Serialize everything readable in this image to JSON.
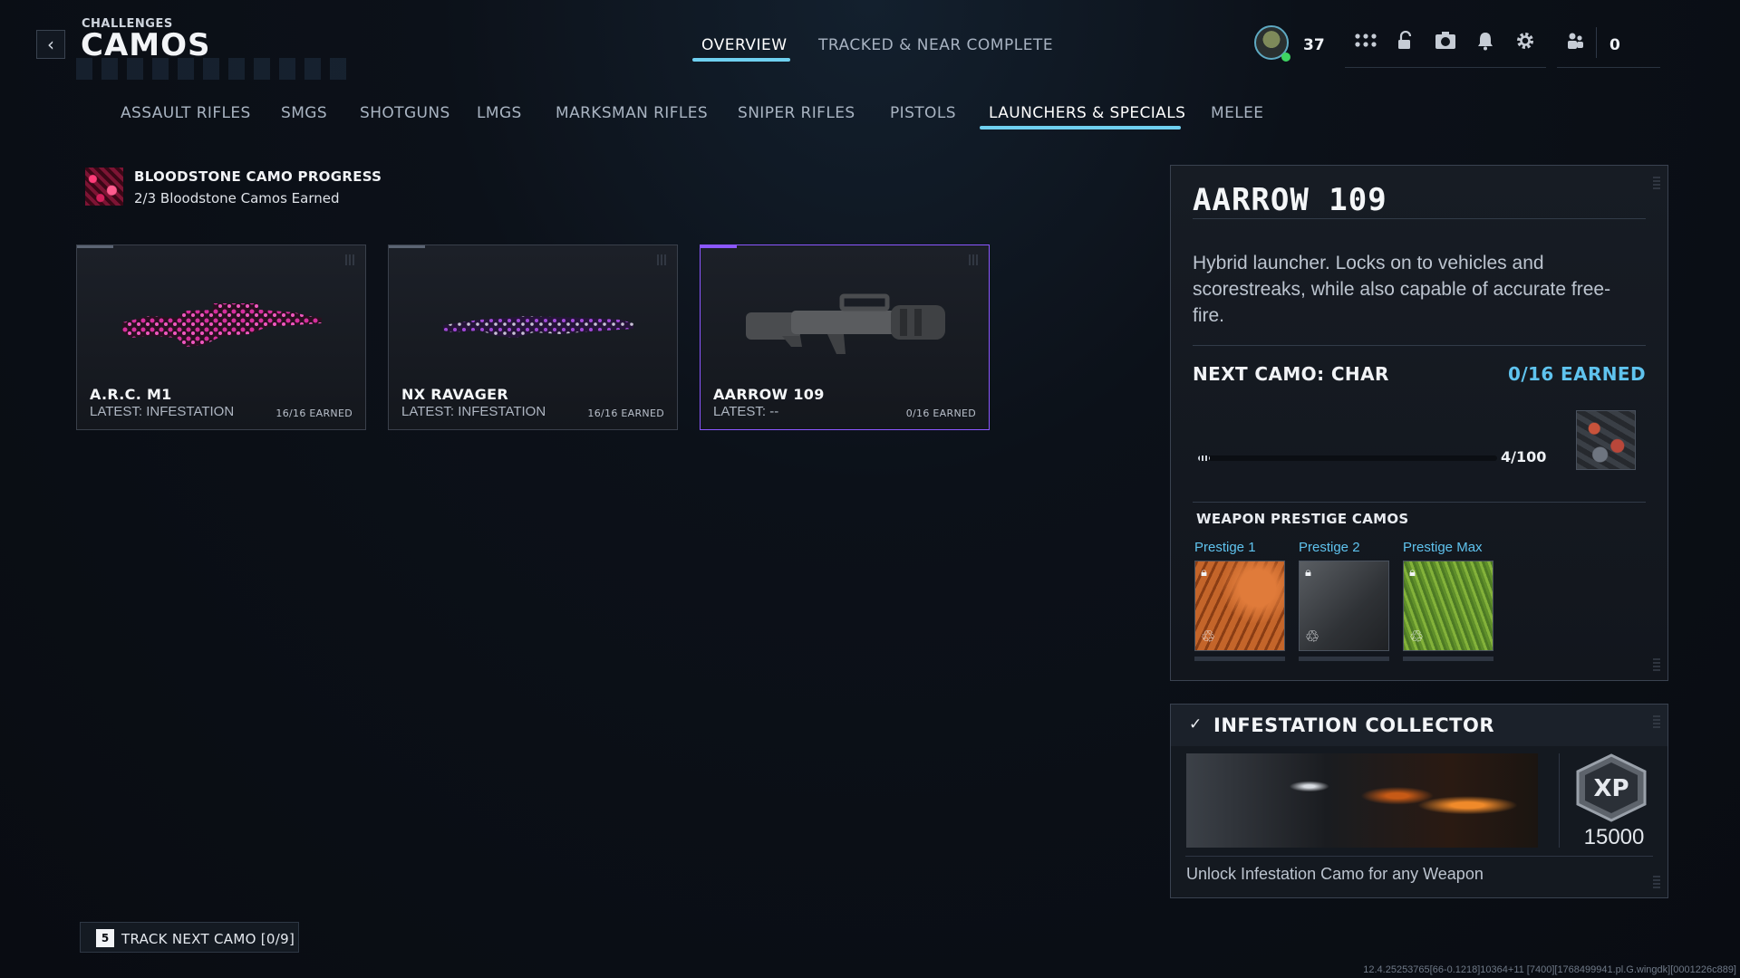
{
  "header": {
    "breadcrumb": "CHALLENGES",
    "title": "CAMOS",
    "tabs": [
      {
        "label": "OVERVIEW",
        "active": true
      },
      {
        "label": "TRACKED & NEAR COMPLETE",
        "active": false
      }
    ],
    "player_level": "37",
    "currency": "0",
    "icons": [
      "apps-icon",
      "unlock-icon",
      "camera-icon",
      "bell-icon",
      "gear-icon",
      "friends-icon"
    ]
  },
  "categories": [
    {
      "label": "ASSAULT RIFLES",
      "active": false
    },
    {
      "label": "SMGS",
      "active": false
    },
    {
      "label": "SHOTGUNS",
      "active": false
    },
    {
      "label": "LMGS",
      "active": false
    },
    {
      "label": "MARKSMAN RIFLES",
      "active": false
    },
    {
      "label": "SNIPER RIFLES",
      "active": false
    },
    {
      "label": "PISTOLS",
      "active": false
    },
    {
      "label": "LAUNCHERS & SPECIALS",
      "active": true
    },
    {
      "label": "MELEE",
      "active": false
    }
  ],
  "bloodstone": {
    "title": "BLOODSTONE CAMO PROGRESS",
    "subtitle": "2/3 Bloodstone Camos Earned"
  },
  "weapons": [
    {
      "name": "A.R.C. M1",
      "latest": "LATEST: INFESTATION",
      "earned": "16/16 EARNED",
      "selected": false
    },
    {
      "name": "NX RAVAGER",
      "latest": "LATEST: INFESTATION",
      "earned": "16/16 EARNED",
      "selected": false
    },
    {
      "name": "AARROW 109",
      "latest": "LATEST: --",
      "earned": "0/16 EARNED",
      "selected": true
    }
  ],
  "detail": {
    "title": "AARROW 109",
    "description": "Hybrid launcher. Locks on to vehicles and scorestreaks, while also capable of accurate free-fire.",
    "next_camo": "NEXT CAMO: CHAR",
    "earned": "0/16 EARNED",
    "progress_text": "4/100",
    "progress_fraction": 0.04,
    "prestige_heading": "WEAPON PRESTIGE CAMOS",
    "prestige_camos": [
      {
        "label": "Prestige 1"
      },
      {
        "label": "Prestige 2"
      },
      {
        "label": "Prestige Max"
      }
    ]
  },
  "collector": {
    "title": "INFESTATION COLLECTOR",
    "xp_badge": "XP",
    "xp_value": "15000",
    "description": "Unlock Infestation Camo for any Weapon"
  },
  "footer": {
    "track_key": "5",
    "track_label": "TRACK NEXT CAMO [0/9]",
    "build_info": "12.4.25253765[66-0.1218]10364+11 [7400][1768499941.pl.G.wingdk][0001226c889]"
  },
  "colors": {
    "accent_blue": "#5fc3ee",
    "tab_underline": "#6fd0f0",
    "selected_purple": "#8b57ff",
    "online_green": "#3ed462"
  }
}
